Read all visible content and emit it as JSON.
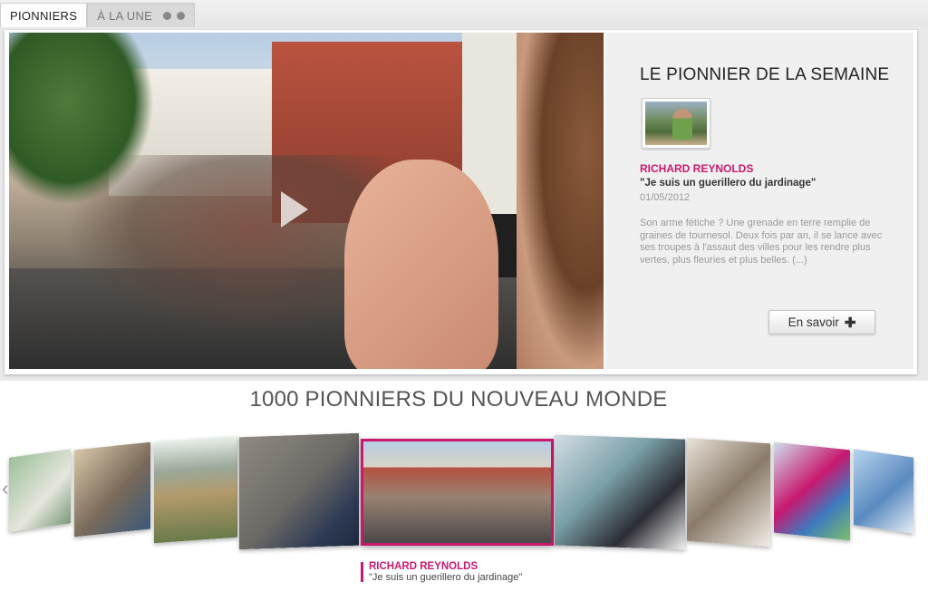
{
  "tabs": [
    {
      "label": "PIONNIERS",
      "active": true
    },
    {
      "label": "À LA UNE",
      "active": false
    }
  ],
  "featured": {
    "heading": "LE PIONNIER DE LA SEMAINE",
    "name": "RICHARD REYNOLDS",
    "quote": "\"Je suis un guerillero du jardinage\"",
    "date": "01/05/2012",
    "description": "Son arme fétiche ? Une grenade en terre remplie de graines de tournesol. Deux fois par an, il se lance avec ses troupes à l'assaut des villes pour les rendre plus vertes, plus fleuries et plus belles. (...)",
    "more_label": "En savoir",
    "more_icon": "plus-icon"
  },
  "carousel": {
    "title": "1000 PIONNIERS DU NOUVEAU MONDE",
    "selected_index": 4,
    "caption": {
      "name": "RICHARD REYNOLDS",
      "quote": "\"Je suis un guerillero du jardinage\""
    },
    "arrows": {
      "left": "‹",
      "right": "›"
    }
  },
  "colors": {
    "accent": "#c8196f",
    "text_dark": "#222222",
    "text_muted": "#999999"
  }
}
